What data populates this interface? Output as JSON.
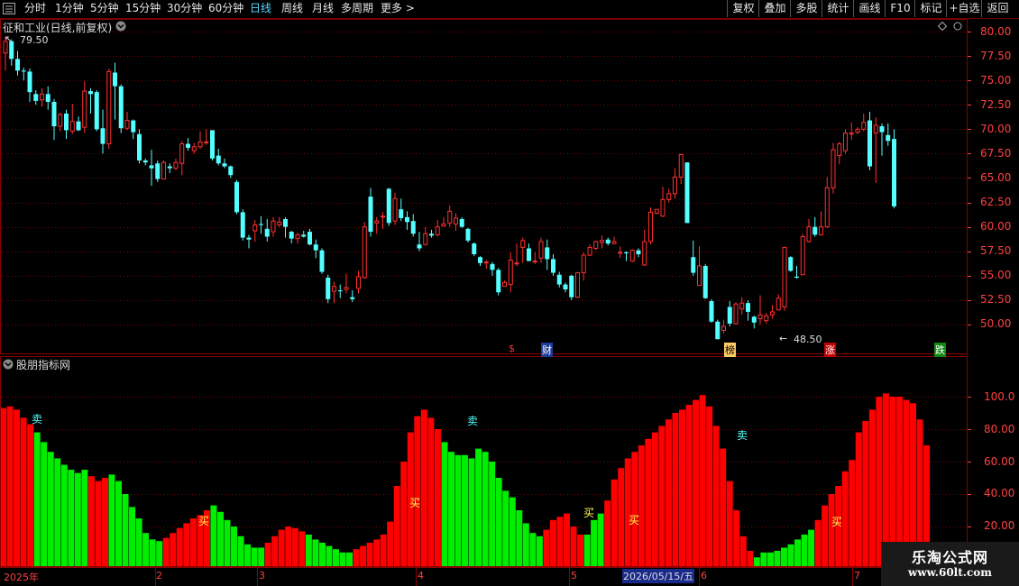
{
  "toolbar": {
    "periods": [
      "分时",
      "1分钟",
      "5分钟",
      "15分钟",
      "30分钟",
      "60分钟",
      "日线",
      "周线",
      "月线",
      "多周期",
      "更多 >"
    ],
    "active_period": "日线",
    "right_buttons": [
      "复权",
      "叠加",
      "多股",
      "统计",
      "画线",
      "F10",
      "标记",
      "+自选",
      "返回"
    ]
  },
  "main": {
    "title": "征和工业(日线,前复权)",
    "high_label": "79.50",
    "low_label": "48.50",
    "event_markers": [
      "$",
      "财",
      "榜",
      "涨",
      "跌"
    ],
    "price_axis": [
      "80.00",
      "77.50",
      "75.00",
      "72.50",
      "70.00",
      "67.50",
      "65.00",
      "62.50",
      "60.00",
      "57.50",
      "55.00",
      "52.50",
      "50.00"
    ]
  },
  "indicator": {
    "title": "股朋指标网",
    "axis": [
      "100.0",
      "80.00",
      "60.00",
      "40.00",
      "20.00"
    ],
    "signals": [
      "卖",
      "买",
      "卖",
      "买",
      "买",
      "卖",
      "买",
      "买"
    ]
  },
  "timeline": {
    "labels": [
      "2025年",
      "2",
      "3",
      "4",
      "5",
      "2026/05/15/五",
      "6",
      "7"
    ]
  },
  "watermark": {
    "title": "乐淘公式网",
    "url": "www.60lt.com"
  },
  "colors": {
    "up": "#ff3030",
    "down": "#54ffff",
    "bar_up": "#ff0000",
    "bar_down": "#00ee00",
    "grid": "#7a0000"
  },
  "chart_data": [
    {
      "type": "candlestick",
      "title": "征和工业(日线,前复权)",
      "ylim": [
        47.5,
        81
      ],
      "candles": [
        [
          77.8,
          79.0,
          79.5,
          76.0
        ],
        [
          79.0,
          77.2,
          79.2,
          76.5
        ],
        [
          77.2,
          76.0,
          78.0,
          75.5
        ],
        [
          76.0,
          75.9,
          76.3,
          75.0
        ],
        [
          75.9,
          73.8,
          76.2,
          72.8
        ],
        [
          73.6,
          72.9,
          74.0,
          72.5
        ],
        [
          73.0,
          73.6,
          74.2,
          72.3
        ],
        [
          73.6,
          72.8,
          74.4,
          72.0
        ],
        [
          72.8,
          70.3,
          73.1,
          68.9
        ],
        [
          70.3,
          71.5,
          71.7,
          69.8
        ],
        [
          71.6,
          69.9,
          72.0,
          69.0
        ],
        [
          69.8,
          70.8,
          72.6,
          69.5
        ],
        [
          70.8,
          69.9,
          71.3,
          69.8
        ],
        [
          70.2,
          73.9,
          74.9,
          69.6
        ],
        [
          73.9,
          73.6,
          74.2,
          71.6
        ],
        [
          73.8,
          70.0,
          74.0,
          69.8
        ],
        [
          70.1,
          68.5,
          72.0,
          67.5
        ],
        [
          68.5,
          75.9,
          76.2,
          68.0
        ],
        [
          75.8,
          74.4,
          76.8,
          71.0
        ],
        [
          74.4,
          70.1,
          74.6,
          69.6
        ],
        [
          70.1,
          70.9,
          71.8,
          69.9
        ],
        [
          70.9,
          69.7,
          71.0,
          69.0
        ],
        [
          69.5,
          66.8,
          70.0,
          66.5
        ],
        [
          66.8,
          66.6,
          67.0,
          66.3
        ],
        [
          66.3,
          66.0,
          67.9,
          64.2
        ],
        [
          66.5,
          64.9,
          66.8,
          64.6
        ],
        [
          64.9,
          66.6,
          66.8,
          65.8
        ],
        [
          66.2,
          66.0,
          66.5,
          65.5
        ],
        [
          66.0,
          66.6,
          67.0,
          65.8
        ],
        [
          66.5,
          68.5,
          68.8,
          65.3
        ],
        [
          68.5,
          68.1,
          69.1,
          67.8
        ],
        [
          67.8,
          68.2,
          68.6,
          67.5
        ],
        [
          68.2,
          68.7,
          69.8,
          68.0
        ],
        [
          68.7,
          68.7,
          70.0,
          68.4
        ],
        [
          69.9,
          67.0,
          69.9,
          66.8
        ],
        [
          67.3,
          66.5,
          68.0,
          66.3
        ],
        [
          66.5,
          66.2,
          67.0,
          66.0
        ],
        [
          66.2,
          65.3,
          66.3,
          65.0
        ],
        [
          64.6,
          61.5,
          64.8,
          61.3
        ],
        [
          61.5,
          58.9,
          61.8,
          58.6
        ],
        [
          58.9,
          58.7,
          59.2,
          57.8
        ],
        [
          59.6,
          60.2,
          60.7,
          58.5
        ],
        [
          60.3,
          60.2,
          61.1,
          59.3
        ],
        [
          59.8,
          59.0,
          60.8,
          58.5
        ],
        [
          59.5,
          60.6,
          61.0,
          59.0
        ],
        [
          60.2,
          60.5,
          61.0,
          60.0
        ],
        [
          60.8,
          60.0,
          61.0,
          58.9
        ],
        [
          59.5,
          58.8,
          59.6,
          58.3
        ],
        [
          58.8,
          59.2,
          59.4,
          58.3
        ],
        [
          59.2,
          59.0,
          59.6,
          58.9
        ],
        [
          59.5,
          58.2,
          59.8,
          58.1
        ],
        [
          58.2,
          57.6,
          58.7,
          56.8
        ],
        [
          57.6,
          55.4,
          57.8,
          55.2
        ],
        [
          54.8,
          52.6,
          55.1,
          52.2
        ],
        [
          53.4,
          53.9,
          54.4,
          52.2
        ],
        [
          53.5,
          53.4,
          54.1,
          52.7
        ],
        [
          53.6,
          53.8,
          55.2,
          53.2
        ],
        [
          52.8,
          52.6,
          53.5,
          52.3
        ],
        [
          53.7,
          54.9,
          55.5,
          53.2
        ],
        [
          54.8,
          60.0,
          60.5,
          54.7
        ],
        [
          63.1,
          59.5,
          64.0,
          59.0
        ],
        [
          60.4,
          60.6,
          61.0,
          59.3
        ],
        [
          61.0,
          61.1,
          61.5,
          59.8
        ],
        [
          63.9,
          60.4,
          64.0,
          60.1
        ],
        [
          60.6,
          62.9,
          63.5,
          60.2
        ],
        [
          61.8,
          60.9,
          62.9,
          60.6
        ],
        [
          61.0,
          60.5,
          61.6,
          59.7
        ],
        [
          60.6,
          59.3,
          61.3,
          59.0
        ],
        [
          58.2,
          57.8,
          59.5,
          57.5
        ],
        [
          58.2,
          59.3,
          60.0,
          58.1
        ],
        [
          59.3,
          59.1,
          59.7,
          58.9
        ],
        [
          59.2,
          60.0,
          60.7,
          59.0
        ],
        [
          60.1,
          60.3,
          61.0,
          60.0
        ],
        [
          60.4,
          61.6,
          62.2,
          60.0
        ],
        [
          60.3,
          60.9,
          61.4,
          59.6
        ],
        [
          60.8,
          60.0,
          61.0,
          59.9
        ],
        [
          59.8,
          58.6,
          59.9,
          58.4
        ],
        [
          58.3,
          57.2,
          58.4,
          57.0
        ],
        [
          56.9,
          56.3,
          57.0,
          56.0
        ],
        [
          56.4,
          56.4,
          56.6,
          55.7
        ],
        [
          56.2,
          55.6,
          56.4,
          55.0
        ],
        [
          55.6,
          53.3,
          55.8,
          53.0
        ],
        [
          53.9,
          54.3,
          54.5,
          54.1
        ],
        [
          54.1,
          56.6,
          57.4,
          53.3
        ],
        [
          56.3,
          56.3,
          58.3,
          56.0
        ],
        [
          57.9,
          58.6,
          58.9,
          56.3
        ],
        [
          57.8,
          56.5,
          58.3,
          56.5
        ],
        [
          56.5,
          56.5,
          57.4,
          56.2
        ],
        [
          56.8,
          58.5,
          58.9,
          56.3
        ],
        [
          57.9,
          56.7,
          58.7,
          55.6
        ],
        [
          56.7,
          55.3,
          57.2,
          55.0
        ],
        [
          55.1,
          54.1,
          55.4,
          53.8
        ],
        [
          54.1,
          53.6,
          54.3,
          53.3
        ],
        [
          55.0,
          52.8,
          55.1,
          52.5
        ],
        [
          52.8,
          55.3,
          55.4,
          52.7
        ],
        [
          55.3,
          57.1,
          57.4,
          54.5
        ],
        [
          57.1,
          57.9,
          58.2,
          57.0
        ],
        [
          57.8,
          58.5,
          58.6,
          57.6
        ],
        [
          58.4,
          58.6,
          59.1,
          57.8
        ],
        [
          58.7,
          58.3,
          58.9,
          58.1
        ],
        [
          58.3,
          58.5,
          59.0,
          58.2
        ],
        [
          57.3,
          57.4,
          58.0,
          56.8
        ],
        [
          57.4,
          57.3,
          57.5,
          56.5
        ],
        [
          56.5,
          57.6,
          57.7,
          56.4
        ],
        [
          57.6,
          57.2,
          57.8,
          56.9
        ],
        [
          56.1,
          58.5,
          59.7,
          56.0
        ],
        [
          58.5,
          61.5,
          62.0,
          58.2
        ],
        [
          61.4,
          61.8,
          61.8,
          61.3
        ],
        [
          61.1,
          62.8,
          64.1,
          61.0
        ],
        [
          62.8,
          63.4,
          63.9,
          62.5
        ],
        [
          63.4,
          65.1,
          66.0,
          62.9
        ],
        [
          65.1,
          67.4,
          67.5,
          64.4
        ],
        [
          66.6,
          60.4,
          66.6,
          60.4
        ],
        [
          56.9,
          55.3,
          58.6,
          55.0
        ],
        [
          54.0,
          56.0,
          58.0,
          55.8
        ],
        [
          56.0,
          52.7,
          56.2,
          52.6
        ],
        [
          52.4,
          50.3,
          52.6,
          50.2
        ],
        [
          50.3,
          48.5,
          50.5,
          48.5
        ],
        [
          49.4,
          49.8,
          50.5,
          49.1
        ],
        [
          51.8,
          50.1,
          52.4,
          49.8
        ],
        [
          50.1,
          52.1,
          52.3,
          50.0
        ],
        [
          51.6,
          52.2,
          52.8,
          51.0
        ],
        [
          52.2,
          51.3,
          52.5,
          50.4
        ],
        [
          50.8,
          50.2,
          50.9,
          49.6
        ],
        [
          50.6,
          51.0,
          53.0,
          50.0
        ],
        [
          50.4,
          50.9,
          51.2,
          50.1
        ],
        [
          51.0,
          51.3,
          52.0,
          50.6
        ],
        [
          51.5,
          52.7,
          53.1,
          51.5
        ],
        [
          51.8,
          57.9,
          58.0,
          51.4
        ],
        [
          56.9,
          55.5,
          57.0,
          55.4
        ],
        [
          54.9,
          54.8,
          56.0,
          54.7
        ],
        [
          55.1,
          59.0,
          59.3,
          55.1
        ],
        [
          58.5,
          60.0,
          60.8,
          58.4
        ],
        [
          60.0,
          59.2,
          61.0,
          59.0
        ],
        [
          59.2,
          60.0,
          61.6,
          59.1
        ],
        [
          60.0,
          64.0,
          65.1,
          59.9
        ],
        [
          64.0,
          67.9,
          68.6,
          63.4
        ],
        [
          67.3,
          68.5,
          68.7,
          66.4
        ],
        [
          67.8,
          69.6,
          70.0,
          67.5
        ],
        [
          69.6,
          69.6,
          70.7,
          68.9
        ],
        [
          69.7,
          70.0,
          70.2,
          69.5
        ],
        [
          70.0,
          70.7,
          71.6,
          69.8
        ],
        [
          70.9,
          66.2,
          71.8,
          65.8
        ],
        [
          69.6,
          70.4,
          71.2,
          64.5
        ],
        [
          70.3,
          69.7,
          70.6,
          67.3
        ],
        [
          69.4,
          68.8,
          70.6,
          68.3
        ],
        [
          69.0,
          62.1,
          70.0,
          61.9
        ]
      ]
    },
    {
      "type": "bar",
      "title": "股朋指标网",
      "ylim": [
        0,
        110
      ],
      "values": [
        93,
        94,
        92,
        87,
        83,
        78,
        72,
        66,
        62,
        58,
        55,
        53,
        55,
        51,
        48,
        50,
        52,
        48,
        40,
        32,
        25,
        16,
        12,
        11,
        13,
        16,
        19,
        22,
        25,
        27,
        30,
        33,
        29,
        24,
        20,
        14,
        9,
        7,
        7,
        10,
        14,
        18,
        20,
        19,
        17,
        15,
        12,
        10,
        8,
        6,
        4,
        4,
        6,
        8,
        10,
        12,
        15,
        23,
        45,
        60,
        78,
        88,
        92,
        87,
        80,
        72,
        66,
        64,
        64,
        62,
        68,
        66,
        60,
        50,
        42,
        38,
        30,
        22,
        16,
        14,
        18,
        24,
        26,
        28,
        20,
        15,
        15,
        24,
        28,
        36,
        49,
        56,
        62,
        66,
        70,
        74,
        78,
        82,
        86,
        90,
        92,
        95,
        98,
        101,
        94,
        82,
        68,
        48,
        30,
        14,
        5,
        1,
        4,
        4,
        5,
        7,
        9,
        12,
        15,
        18,
        24,
        33,
        40,
        45,
        54,
        61,
        78,
        85,
        92,
        100,
        102,
        100,
        100,
        98,
        96,
        86,
        70
      ],
      "colors": "rrrrrggggggggrrrggggggggrrrrrrrggggggggrrrrrrgggggggrrrrrrrrrrrrrgggggggggggggggrrrrrrgggrrrrrrrrrrrrrrrrrrrrrrgggggggggrrrrrrrrrrrrrrrrrrrrrrgggggggggg"
    }
  ]
}
